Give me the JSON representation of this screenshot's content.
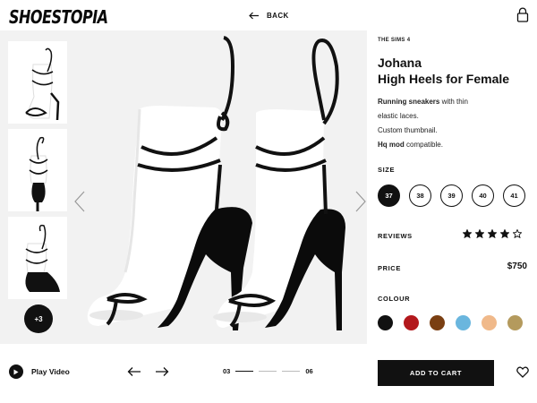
{
  "brand": {
    "logo": "SHOESTOPIA"
  },
  "header": {
    "back_label": "BACK"
  },
  "gallery": {
    "more_label": "+3"
  },
  "product": {
    "eyebrow": "THE SIMS 4",
    "title_line1": "Johana",
    "title_line2": "High Heels for Female",
    "description": [
      {
        "bold": "Running sneakers",
        "rest": " with thin"
      },
      {
        "bold": "",
        "rest": "elastic laces."
      },
      {
        "bold": "",
        "rest": "Custom thumbnail."
      },
      {
        "bold": "Hq mod",
        "rest": " compatible."
      }
    ],
    "size_label": "SIZE",
    "sizes": [
      "37",
      "38",
      "39",
      "40",
      "41"
    ],
    "selected_size": "37",
    "reviews_label": "REVIEWS",
    "rating": 4,
    "rating_max": 5,
    "price_label": "PRICE",
    "price": "$750",
    "colour_label": "COLOUR",
    "colours": [
      {
        "name": "black",
        "hex": "#111111"
      },
      {
        "name": "red",
        "hex": "#b3181c"
      },
      {
        "name": "brown",
        "hex": "#7a3f12"
      },
      {
        "name": "sky-blue",
        "hex": "#6ab6de"
      },
      {
        "name": "peach",
        "hex": "#f0b98a"
      },
      {
        "name": "tan",
        "hex": "#b49a5d"
      }
    ]
  },
  "footer": {
    "play_label": "Play Video",
    "page_current": "03",
    "page_total": "06",
    "cart_label": "ADD TO CART"
  },
  "icons": [
    "back-arrow-icon",
    "lock-icon",
    "chevron-left-icon",
    "chevron-right-icon",
    "play-icon",
    "arrow-left-icon",
    "arrow-right-icon",
    "heart-icon",
    "star-icon"
  ]
}
